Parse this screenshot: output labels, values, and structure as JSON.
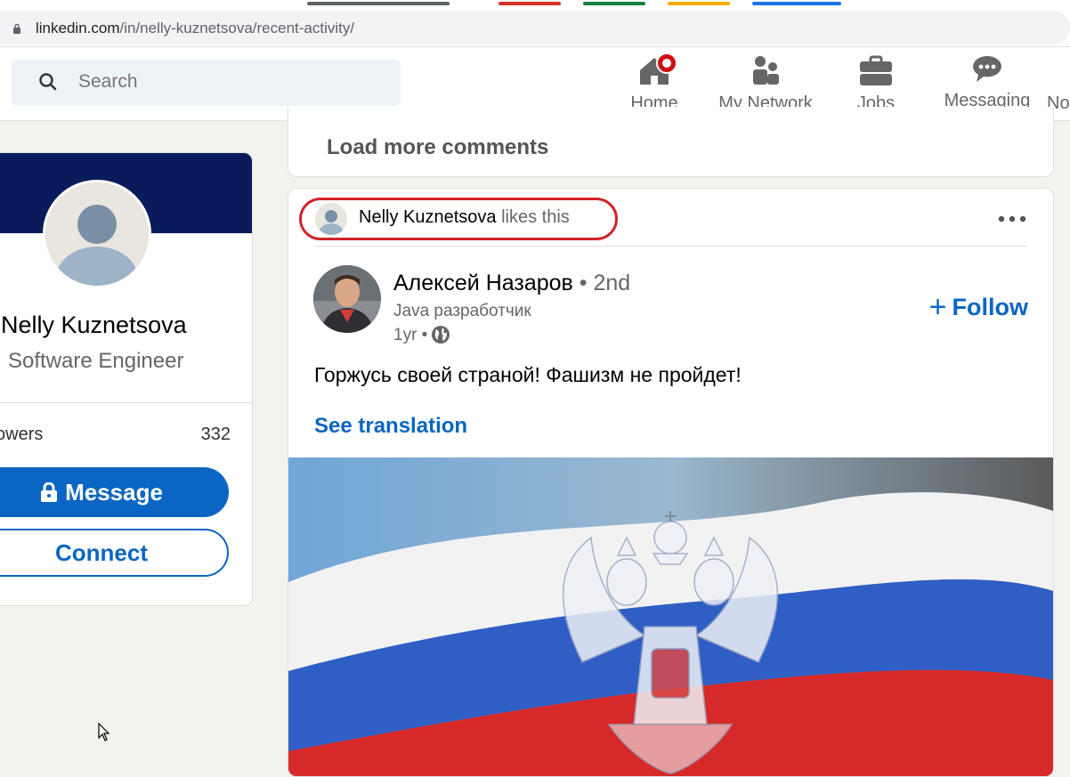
{
  "browser": {
    "url_host": "linkedin.com",
    "url_path": "/in/nelly-kuznetsova/recent-activity/",
    "tab_colors": [
      "#5f6368",
      "#d93025",
      "#188038",
      "#f9ab00",
      "#1a73e8"
    ]
  },
  "header": {
    "search_placeholder": "Search",
    "nav": [
      {
        "label": "Home",
        "icon": "home-icon"
      },
      {
        "label": "My Network",
        "icon": "network-icon"
      },
      {
        "label": "Jobs",
        "icon": "briefcase-icon"
      },
      {
        "label": "Messaging",
        "icon": "messaging-icon"
      },
      {
        "label": "No",
        "icon": "notifications-icon"
      }
    ]
  },
  "profile": {
    "name": "Nelly Kuznetsova",
    "title": "Software Engineer",
    "followers_label": "owers",
    "followers_count": "332",
    "message_label": "Message",
    "connect_label": "Connect",
    "banner_color": "#0a1b5c"
  },
  "feed": {
    "load_more_label": "Load more comments",
    "post": {
      "actor_name": "Nelly Kuznetsova",
      "actor_action": "likes this",
      "author_name": "Алексей Назаров",
      "author_degree": "• 2nd",
      "author_headline": "Java разработчик",
      "time": "1yr •",
      "follow_label": "Follow",
      "text": "Горжусь своей страной! Фашизм не пройдет!",
      "see_translation": "See translation"
    }
  },
  "colors": {
    "accent": "#0a66c2",
    "highlight": "#d3222a",
    "page_bg": "#f3f2ef"
  }
}
